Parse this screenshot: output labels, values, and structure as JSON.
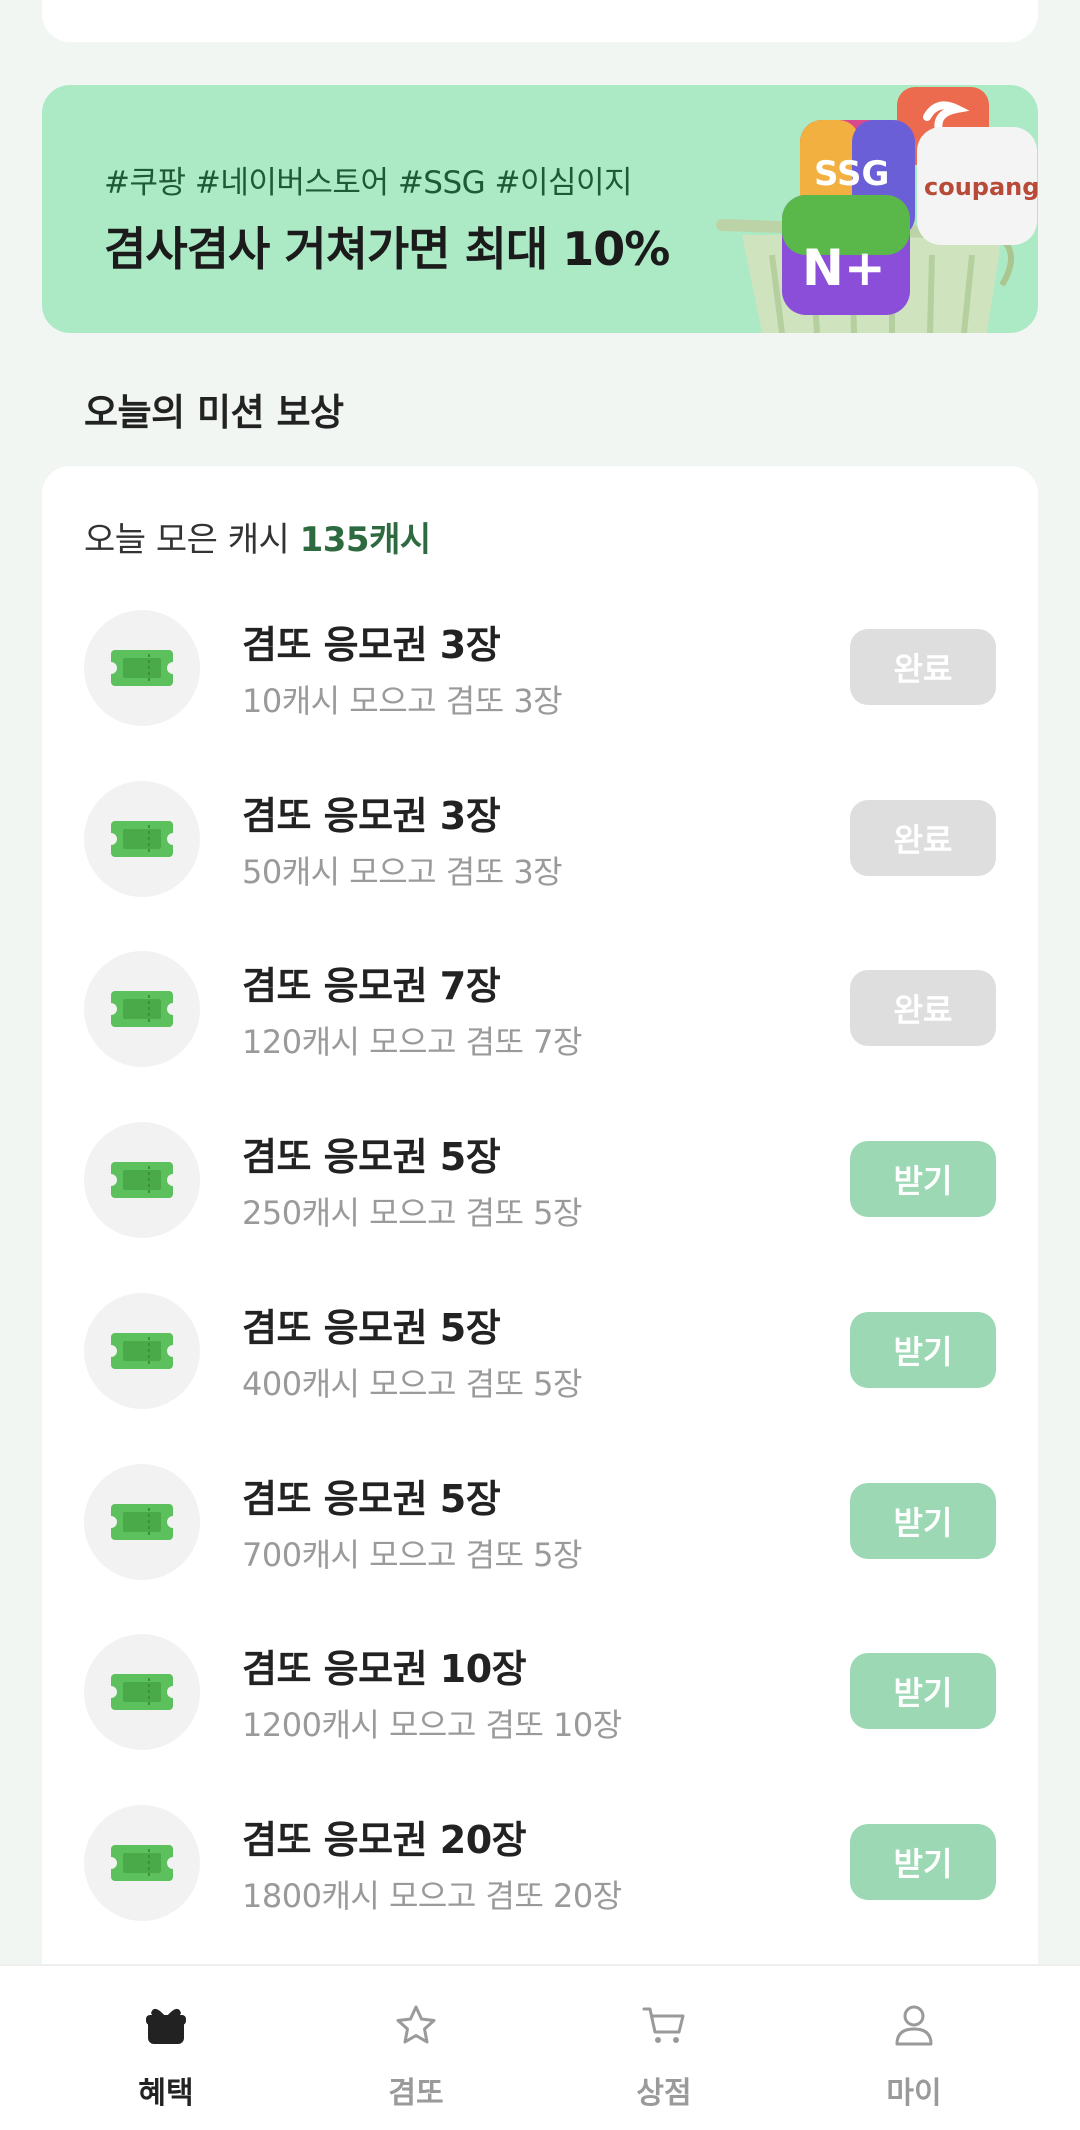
{
  "banner": {
    "tags": "#쿠팡 #네이버스토어 #SSG #이심이지",
    "title": "겸사겸사 거쳐가면 최대 10%",
    "art_labels": {
      "ssg": "SSG",
      "coupang": "coupang",
      "naver": "N+"
    }
  },
  "section_title": "오늘의 미션 보상",
  "cash_summary": {
    "prefix": "오늘 모은 캐시 ",
    "amount": "135캐시"
  },
  "missions": [
    {
      "title": "겸또 응모권 3장",
      "subtitle": "10캐시 모으고 겸또 3장",
      "button": "완료",
      "state": "done"
    },
    {
      "title": "겸또 응모권 3장",
      "subtitle": "50캐시 모으고 겸또 3장",
      "button": "완료",
      "state": "done"
    },
    {
      "title": "겸또 응모권 7장",
      "subtitle": "120캐시 모으고 겸또 7장",
      "button": "완료",
      "state": "done"
    },
    {
      "title": "겸또 응모권 5장",
      "subtitle": "250캐시 모으고 겸또 5장",
      "button": "받기",
      "state": "claim"
    },
    {
      "title": "겸또 응모권 5장",
      "subtitle": "400캐시 모으고 겸또 5장",
      "button": "받기",
      "state": "claim"
    },
    {
      "title": "겸또 응모권 5장",
      "subtitle": "700캐시 모으고 겸또 5장",
      "button": "받기",
      "state": "claim"
    },
    {
      "title": "겸또 응모권 10장",
      "subtitle": "1200캐시 모으고 겸또 10장",
      "button": "받기",
      "state": "claim"
    },
    {
      "title": "겸또 응모권 20장",
      "subtitle": "1800캐시 모으고 겸또 20장",
      "button": "받기",
      "state": "claim"
    }
  ],
  "nav": [
    {
      "label": "혜택",
      "icon": "gift-icon",
      "active": true
    },
    {
      "label": "겸또",
      "icon": "star-icon",
      "active": false
    },
    {
      "label": "상점",
      "icon": "cart-icon",
      "active": false
    },
    {
      "label": "마이",
      "icon": "person-icon",
      "active": false
    }
  ],
  "colors": {
    "background": "#f1f6f3",
    "banner": "#ace9c5",
    "accent": "#2d6a3f",
    "claim_button": "#9cd8b4",
    "done_button": "#dedede",
    "ticket": "#5cc05c"
  }
}
